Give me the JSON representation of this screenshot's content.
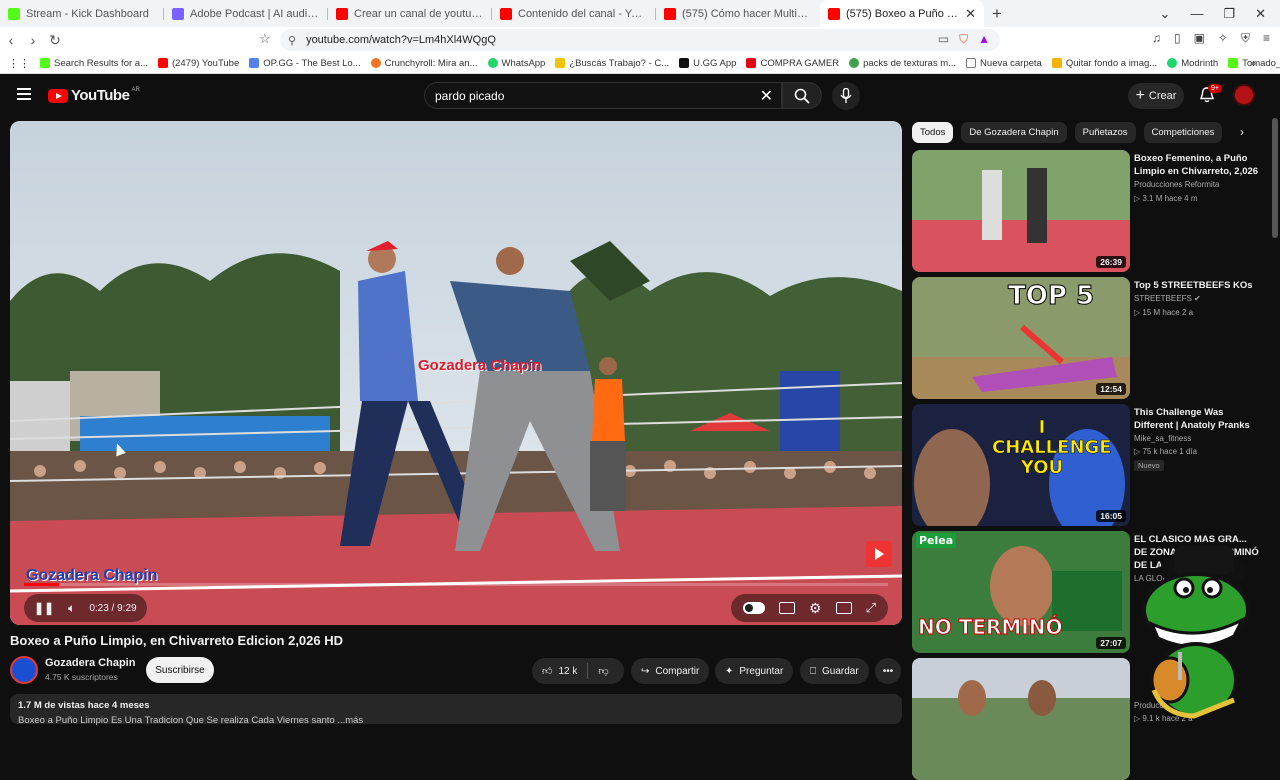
{
  "browser": {
    "tabs": [
      {
        "title": "Stream - Kick Dashboard",
        "color": "#53fc18",
        "active": false
      },
      {
        "title": "Adobe Podcast | AI audio recording a",
        "color": "#7b61ff",
        "active": false
      },
      {
        "title": "Crear un canal de youtube va a camb",
        "color": "#ff0000",
        "active": false
      },
      {
        "title": "Contenido del canal - YouTube Studio",
        "color": "#ff0000",
        "active": false
      },
      {
        "title": "(575) Cómo hacer Multistream gratis",
        "color": "#ff0000",
        "active": false
      },
      {
        "title": "(575) Boxeo a Puño Limpio, e",
        "color": "#ff0000",
        "active": true
      }
    ],
    "new_tab": "+",
    "url": "youtube.com/watch?v=Lm4hXl4WQgQ",
    "bookmarks": [
      {
        "label": "Search Results for a...",
        "color": "#53fc18"
      },
      {
        "label": "(2479) YouTube",
        "color": "#ff0000"
      },
      {
        "label": "OP.GG - The Best Lo...",
        "color": "#5383e8"
      },
      {
        "label": "Crunchyroll: Mira an...",
        "color": "#f47521"
      },
      {
        "label": "WhatsApp",
        "color": "#25d366"
      },
      {
        "label": "¿Buscás Trabajo? - C...",
        "color": "#f5c400"
      },
      {
        "label": "U.GG App",
        "color": "#111111"
      },
      {
        "label": "COMPRA GAMER",
        "color": "#e30613"
      },
      {
        "label": "packs de texturas m...",
        "color": "#3fa34d"
      },
      {
        "label": "Nueva carpeta",
        "color": "#777777"
      },
      {
        "label": "Quitar fondo a imag...",
        "color": "#f4b400"
      },
      {
        "label": "Modrinth",
        "color": "#1bd96a"
      },
      {
        "label": "Tomado_arg Stream...",
        "color": "#53fc18"
      }
    ]
  },
  "yt": {
    "logo_text": "YouTube",
    "country": "AR",
    "search_value": "pardo picado",
    "create_label": "Crear",
    "notif_count": "9+"
  },
  "player": {
    "watermark": "Gozadera Chapin",
    "time": "0:23 / 9:29",
    "progress": 0.04
  },
  "video": {
    "title": "Boxeo a Puño Limpio, en Chivarreto Edicion 2,026 HD",
    "channel": "Gozadera Chapin",
    "subs": "4.75 K suscriptores",
    "subscribe": "Suscribirse",
    "likes": "12 k",
    "share": "Compartir",
    "ask": "Preguntar",
    "save": "Guardar",
    "views": "1.7 M de vistas  hace 4 meses",
    "desc_line": "Boxeo a Puño Limpio Es Una Tradicion Que Se realiza Cada Viernes santo ...más"
  },
  "chips": [
    "Todos",
    "De Gozadera Chapin",
    "Puñetazos",
    "Competiciones"
  ],
  "suggestions": [
    {
      "title": "Boxeo Femenino, a Puño Limpio en Chivarreto,  2,026",
      "channel": "Producciones Reformita",
      "meta": "▷ 3.1 M  hace 4 m",
      "duration": "26:39",
      "badge": ""
    },
    {
      "title": "Top 5 STREETBEEFS KOs",
      "channel": "STREETBEEFS ✔",
      "meta": "▷ 15 M  hace 2 a",
      "duration": "12:54",
      "badge": "",
      "thumb_text": "TOP 5"
    },
    {
      "title": "This Challenge Was Different | Anatoly Pranks",
      "channel": "Mike_sa_fitness",
      "meta": "▷ 75 k  hace 1 día",
      "duration": "16:05",
      "badge": "Nuevo",
      "thumb_text": "I CHALLENGE YOU"
    },
    {
      "title": "EL CLASICO MAS GRA... DE ZONA NORTE TERMINÓ DE LA PEOR MANERA",
      "channel": "LA GLORIO...",
      "meta": "",
      "duration": "27:07",
      "badge": "",
      "thumb_text": "NO TERMINÓ",
      "thumb_text2": "Pelea"
    },
    {
      "title": "",
      "channel": "Producción...",
      "meta": "▷ 9.1 k  hace 2 a",
      "duration": "",
      "badge": ""
    }
  ]
}
